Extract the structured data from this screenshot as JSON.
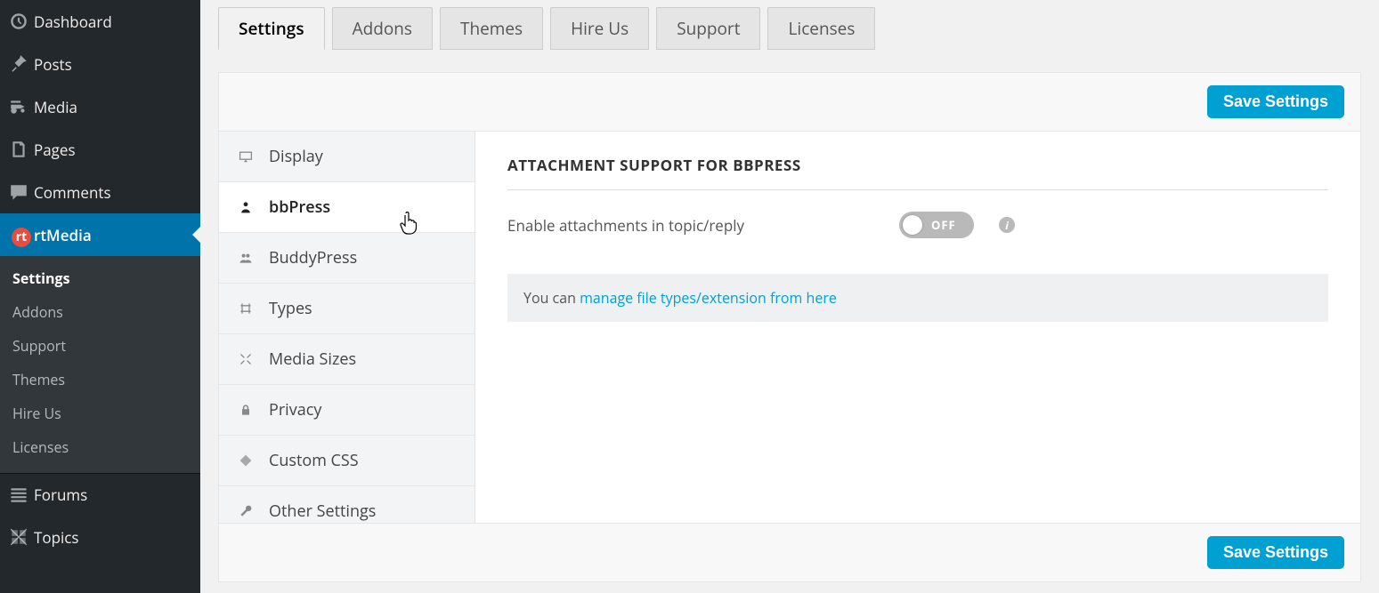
{
  "sidebar": {
    "items": [
      {
        "label": "Dashboard",
        "icon": "dashboard"
      },
      {
        "label": "Posts",
        "icon": "pin"
      },
      {
        "label": "Media",
        "icon": "media"
      },
      {
        "label": "Pages",
        "icon": "pages"
      },
      {
        "label": "Comments",
        "icon": "comment"
      },
      {
        "label": "rtMedia",
        "icon": "rt"
      },
      {
        "label": "Forums",
        "icon": "forums"
      },
      {
        "label": "Topics",
        "icon": "topics"
      }
    ],
    "subitems": [
      "Settings",
      "Addons",
      "Support",
      "Themes",
      "Hire Us",
      "Licenses"
    ],
    "activeIndex": 5,
    "activeSubIndex": 0
  },
  "tabs": {
    "items": [
      "Settings",
      "Addons",
      "Themes",
      "Hire Us",
      "Support",
      "Licenses"
    ],
    "activeIndex": 0
  },
  "saveLabel": "Save Settings",
  "vnav": {
    "items": [
      "Display",
      "bbPress",
      "BuddyPress",
      "Types",
      "Media Sizes",
      "Privacy",
      "Custom CSS",
      "Other Settings"
    ],
    "activeIndex": 1
  },
  "content": {
    "heading": "ATTACHMENT SUPPORT FOR BBPRESS",
    "optionLabel": "Enable attachments in topic/reply",
    "toggleState": "OFF",
    "hintPrefix": "You can ",
    "hintLink": "manage file types/extension from here"
  },
  "colors": {
    "accent": "#00a0d2",
    "sidebarBg": "#23282d",
    "rt": "#e74c3c"
  }
}
